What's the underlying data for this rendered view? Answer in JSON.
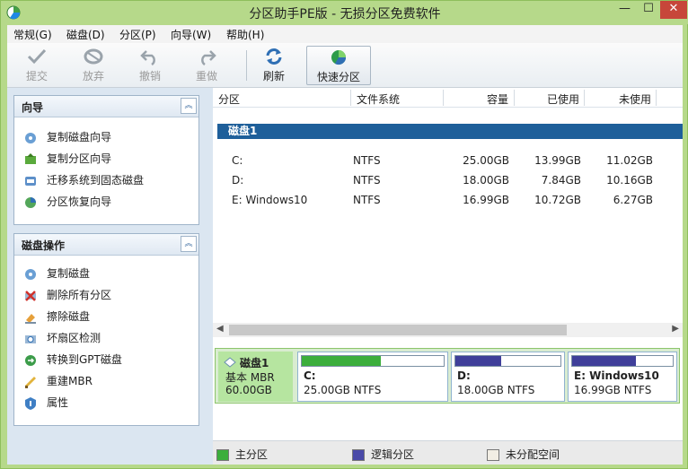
{
  "window": {
    "title": "分区助手PE版 - 无损分区免费软件",
    "min": "—",
    "max": "☐",
    "close": "✕"
  },
  "menu": [
    {
      "label": "常规(G)"
    },
    {
      "label": "磁盘(D)"
    },
    {
      "label": "分区(P)"
    },
    {
      "label": "向导(W)"
    },
    {
      "label": "帮助(H)"
    }
  ],
  "toolbar": {
    "commit": "提交",
    "discard": "放弃",
    "undo": "撤销",
    "redo": "重做",
    "refresh": "刷新",
    "quick_partition": "快速分区"
  },
  "wizard_panel": {
    "title": "向导",
    "items": [
      {
        "label": "复制磁盘向导",
        "icon": "copy-disk-wizard-icon"
      },
      {
        "label": "复制分区向导",
        "icon": "copy-partition-wizard-icon"
      },
      {
        "label": "迁移系统到固态磁盘",
        "icon": "migrate-os-ssd-icon"
      },
      {
        "label": "分区恢复向导",
        "icon": "partition-recovery-icon"
      }
    ]
  },
  "disk_ops_panel": {
    "title": "磁盘操作",
    "items": [
      {
        "label": "复制磁盘",
        "icon": "copy-disk-icon"
      },
      {
        "label": "删除所有分区",
        "icon": "delete-all-partitions-icon"
      },
      {
        "label": "擦除磁盘",
        "icon": "wipe-disk-icon"
      },
      {
        "label": "坏扇区检测",
        "icon": "bad-sector-check-icon"
      },
      {
        "label": "转换到GPT磁盘",
        "icon": "convert-gpt-icon"
      },
      {
        "label": "重建MBR",
        "icon": "rebuild-mbr-icon"
      },
      {
        "label": "属性",
        "icon": "properties-icon"
      }
    ]
  },
  "table": {
    "columns": [
      "分区",
      "文件系统",
      "容量",
      "已使用",
      "未使用"
    ],
    "disk_label": "磁盘1",
    "rows": [
      {
        "partition": "C:",
        "fs": "NTFS",
        "capacity": "25.00GB",
        "used": "13.99GB",
        "free": "11.02GB"
      },
      {
        "partition": "D:",
        "fs": "NTFS",
        "capacity": "18.00GB",
        "used": "7.84GB",
        "free": "10.16GB"
      },
      {
        "partition": "E: Windows10",
        "fs": "NTFS",
        "capacity": "16.99GB",
        "used": "10.72GB",
        "free": "6.27GB"
      }
    ]
  },
  "diskmap": {
    "disk": {
      "name": "磁盘1",
      "type": "基本 MBR",
      "size": "60.00GB"
    },
    "partitions": [
      {
        "label": "C:",
        "detail": "25.00GB NTFS",
        "used_fraction": 0.56,
        "color": "#3cae3c"
      },
      {
        "label": "D:",
        "detail": "18.00GB NTFS",
        "used_fraction": 0.44,
        "color": "#3f3f9a"
      },
      {
        "label": "E: Windows10",
        "detail": "16.99GB NTFS",
        "used_fraction": 0.63,
        "color": "#3f3f9a"
      }
    ]
  },
  "legend": {
    "primary": "主分区",
    "logical": "逻辑分区",
    "unallocated": "未分配空间",
    "colors": {
      "primary": "#3cae3c",
      "logical": "#4a4aa8",
      "unallocated": "#f2eee4"
    }
  }
}
